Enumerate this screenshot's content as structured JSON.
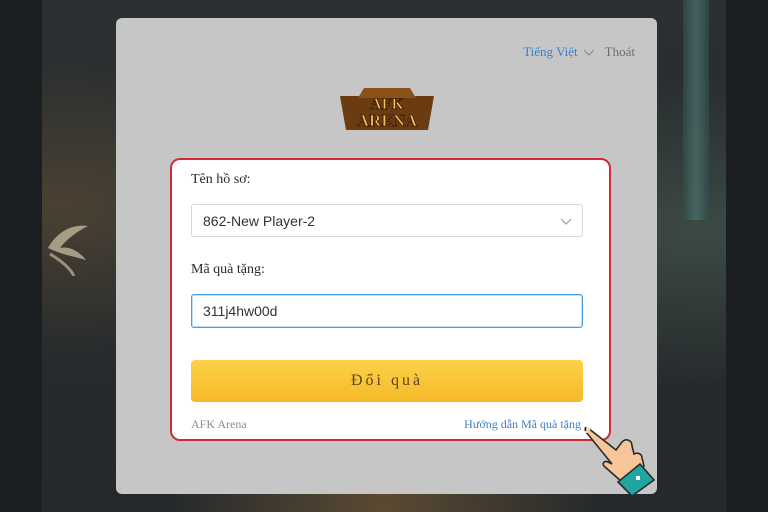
{
  "header": {
    "language_label": "Tiếng Việt",
    "logout_label": "Thoát"
  },
  "logo": {
    "line1": "AFK",
    "line2": "ARENA"
  },
  "form": {
    "profile_label": "Tên hồ sơ:",
    "profile_value": "862-New Player-2",
    "code_label": "Mã quà tặng:",
    "code_value": "311j4hw00d",
    "submit_label": "Đổi quà"
  },
  "footer": {
    "brand": "AFK Arena",
    "guide_link": "Hướng dẫn Mã quà tặng"
  },
  "colors": {
    "accent_link": "#3d7fc3",
    "button": "#f7b82a",
    "highlight_border": "#d22b34"
  }
}
